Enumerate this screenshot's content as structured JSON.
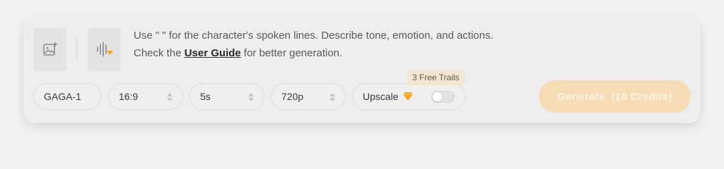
{
  "prompt": {
    "line1": "Use \" \" for the character's spoken lines. Describe tone, emotion, and actions.",
    "line2_prefix": "Check the ",
    "guide_link": "User Guide",
    "line2_suffix": " for better generation."
  },
  "tools": {
    "image_upload_icon": "add-image-icon",
    "audio_icon": "audio-waveform-icon"
  },
  "options": {
    "model": "GAGA-1",
    "aspect_ratio": "16:9",
    "duration": "5s",
    "resolution": "720p",
    "upscale_label": "Upscale",
    "upscale_enabled": false,
    "free_trials_badge": "3 Free Trails"
  },
  "generate": {
    "label": "Generate  (10 Credits)",
    "enabled": false
  },
  "colors": {
    "accent": "#f5a623",
    "generate_bg": "#f6ddb6",
    "badge_bg": "#f2e7d4"
  }
}
